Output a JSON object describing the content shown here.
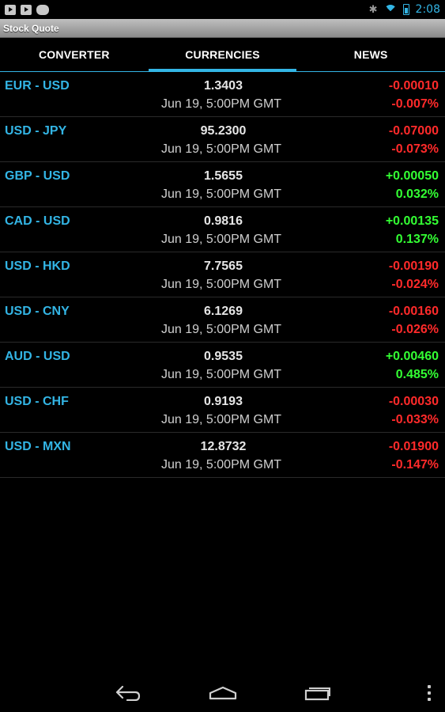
{
  "status_bar": {
    "icons_left": [
      "play-store-icon",
      "play-store-icon",
      "game-controller-icon"
    ],
    "icons_right": [
      "bluetooth-icon",
      "wifi-icon",
      "battery-icon"
    ],
    "time": "2:08"
  },
  "app": {
    "title": "Stock Quote"
  },
  "tabs": [
    {
      "label": "CONVERTER",
      "active": false
    },
    {
      "label": "CURRENCIES",
      "active": true
    },
    {
      "label": "NEWS",
      "active": false
    }
  ],
  "quotes": [
    {
      "pair": "EUR - USD",
      "price": "1.3403",
      "time": "Jun 19, 5:00PM GMT",
      "change": "-0.00010",
      "percent": "-0.007%"
    },
    {
      "pair": "USD - JPY",
      "price": "95.2300",
      "time": "Jun 19, 5:00PM GMT",
      "change": "-0.07000",
      "percent": "-0.073%"
    },
    {
      "pair": "GBP - USD",
      "price": "1.5655",
      "time": "Jun 19, 5:00PM GMT",
      "change": "+0.00050",
      "percent": "0.032%"
    },
    {
      "pair": "CAD - USD",
      "price": "0.9816",
      "time": "Jun 19, 5:00PM GMT",
      "change": "+0.00135",
      "percent": "0.137%"
    },
    {
      "pair": "USD - HKD",
      "price": "7.7565",
      "time": "Jun 19, 5:00PM GMT",
      "change": "-0.00190",
      "percent": "-0.024%"
    },
    {
      "pair": "USD - CNY",
      "price": "6.1269",
      "time": "Jun 19, 5:00PM GMT",
      "change": "-0.00160",
      "percent": "-0.026%"
    },
    {
      "pair": "AUD - USD",
      "price": "0.9535",
      "time": "Jun 19, 5:00PM GMT",
      "change": "+0.00460",
      "percent": "0.485%"
    },
    {
      "pair": "USD - CHF",
      "price": "0.9193",
      "time": "Jun 19, 5:00PM GMT",
      "change": "-0.00030",
      "percent": "-0.033%"
    },
    {
      "pair": "USD - MXN",
      "price": "12.8732",
      "time": "Jun 19, 5:00PM GMT",
      "change": "-0.01900",
      "percent": "-0.147%"
    }
  ],
  "colors": {
    "accent": "#33b5e5",
    "positive": "#33ff33",
    "negative": "#ff2a2a",
    "background": "#000000"
  },
  "nav_bar": {
    "icons": [
      "back-icon",
      "home-icon",
      "recents-icon",
      "menu-icon"
    ]
  }
}
